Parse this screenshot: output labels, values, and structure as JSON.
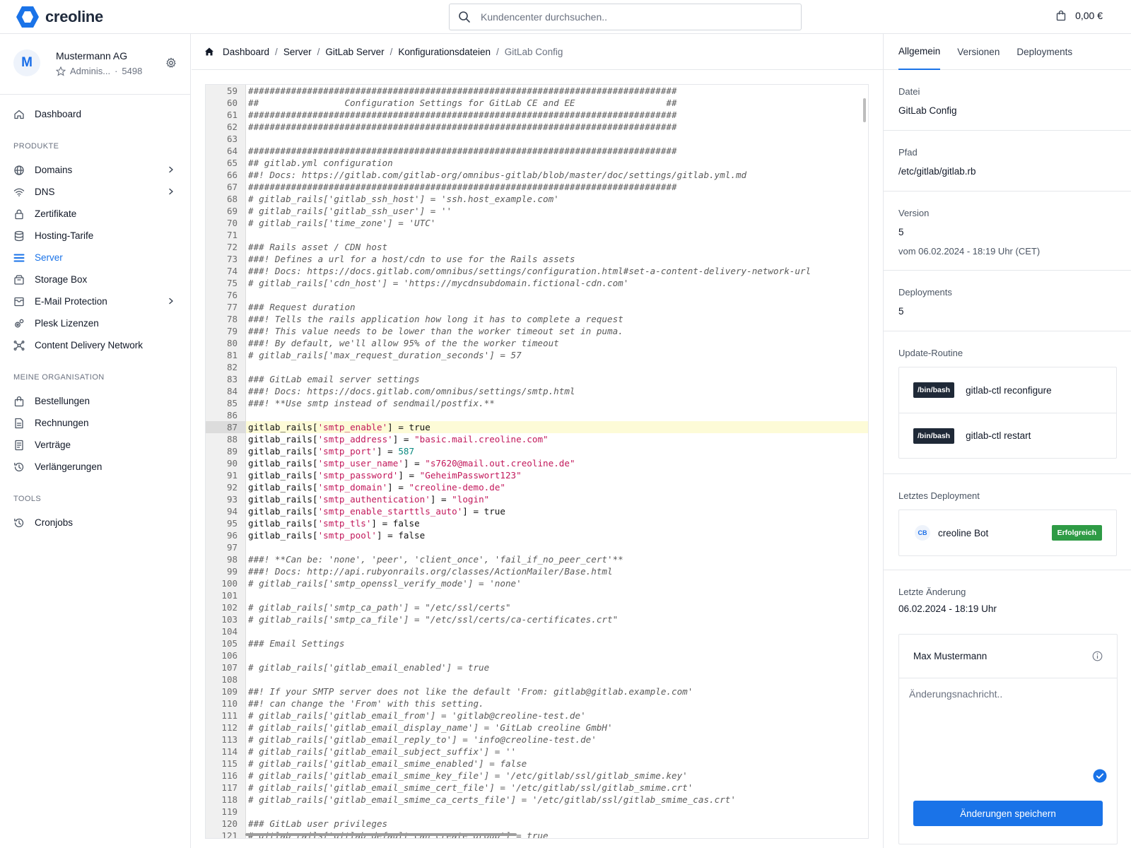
{
  "brand": {
    "name": "creoline",
    "color": "#1a73e8"
  },
  "search": {
    "placeholder": "Kundencenter durchsuchen.."
  },
  "cart": {
    "total": "0,00 €"
  },
  "account": {
    "initial": "M",
    "name": "Mustermann AG",
    "role": "Adminis...",
    "id": "5498"
  },
  "sidebar": {
    "top": [
      {
        "label": "Dashboard",
        "icon": "home-icon"
      }
    ],
    "sections": [
      {
        "title": "PRODUKTE",
        "items": [
          {
            "label": "Domains",
            "icon": "globe-icon",
            "chevron": true
          },
          {
            "label": "DNS",
            "icon": "wifi-icon",
            "chevron": true
          },
          {
            "label": "Zertifikate",
            "icon": "lock-icon"
          },
          {
            "label": "Hosting-Tarife",
            "icon": "database-icon"
          },
          {
            "label": "Server",
            "icon": "server-icon",
            "active": true
          },
          {
            "label": "Storage Box",
            "icon": "box-icon"
          },
          {
            "label": "E-Mail Protection",
            "icon": "mail-icon",
            "chevron": true
          },
          {
            "label": "Plesk Lizenzen",
            "icon": "gears-icon"
          },
          {
            "label": "Content Delivery Network",
            "icon": "network-icon"
          }
        ]
      },
      {
        "title": "MEINE ORGANISATION",
        "items": [
          {
            "label": "Bestellungen",
            "icon": "bag-icon"
          },
          {
            "label": "Rechnungen",
            "icon": "invoice-icon"
          },
          {
            "label": "Verträge",
            "icon": "contract-icon"
          },
          {
            "label": "Verlängerungen",
            "icon": "history-icon"
          }
        ]
      },
      {
        "title": "TOOLS",
        "items": [
          {
            "label": "Cronjobs",
            "icon": "clock-icon"
          }
        ]
      }
    ]
  },
  "breadcrumb": {
    "items": [
      "Dashboard",
      "Server",
      "GitLab Server",
      "Konfigurationsdateien"
    ],
    "current": "GitLab Config"
  },
  "editor": {
    "highlight_line": 87,
    "lines": [
      {
        "n": 59,
        "t": [
          [
            "c",
            "################################################################################"
          ]
        ]
      },
      {
        "n": 60,
        "t": [
          [
            "c",
            "##                Configuration Settings for GitLab CE and EE                 ##"
          ]
        ]
      },
      {
        "n": 61,
        "t": [
          [
            "c",
            "################################################################################"
          ]
        ]
      },
      {
        "n": 62,
        "t": [
          [
            "c",
            "################################################################################"
          ]
        ]
      },
      {
        "n": 63,
        "t": []
      },
      {
        "n": 64,
        "t": [
          [
            "c",
            "################################################################################"
          ]
        ]
      },
      {
        "n": 65,
        "t": [
          [
            "c",
            "## gitlab.yml configuration"
          ]
        ]
      },
      {
        "n": 66,
        "t": [
          [
            "c",
            "##! Docs: https://gitlab.com/gitlab-org/omnibus-gitlab/blob/master/doc/settings/gitlab.yml.md"
          ]
        ]
      },
      {
        "n": 67,
        "t": [
          [
            "c",
            "################################################################################"
          ]
        ]
      },
      {
        "n": 68,
        "t": [
          [
            "c",
            "# gitlab_rails['gitlab_ssh_host'] = 'ssh.host_example.com'"
          ]
        ]
      },
      {
        "n": 69,
        "t": [
          [
            "c",
            "# gitlab_rails['gitlab_ssh_user'] = ''"
          ]
        ]
      },
      {
        "n": 70,
        "t": [
          [
            "c",
            "# gitlab_rails['time_zone'] = 'UTC'"
          ]
        ]
      },
      {
        "n": 71,
        "t": []
      },
      {
        "n": 72,
        "t": [
          [
            "c",
            "### Rails asset / CDN host"
          ]
        ]
      },
      {
        "n": 73,
        "t": [
          [
            "c",
            "###! Defines a url for a host/cdn to use for the Rails assets"
          ]
        ]
      },
      {
        "n": 74,
        "t": [
          [
            "c",
            "###! Docs: https://docs.gitlab.com/omnibus/settings/configuration.html#set-a-content-delivery-network-url"
          ]
        ]
      },
      {
        "n": 75,
        "t": [
          [
            "c",
            "# gitlab_rails['cdn_host'] = 'https://mycdnsubdomain.fictional-cdn.com'"
          ]
        ]
      },
      {
        "n": 76,
        "t": []
      },
      {
        "n": 77,
        "t": [
          [
            "c",
            "### Request duration"
          ]
        ]
      },
      {
        "n": 78,
        "t": [
          [
            "c",
            "###! Tells the rails application how long it has to complete a request"
          ]
        ]
      },
      {
        "n": 79,
        "t": [
          [
            "c",
            "###! This value needs to be lower than the worker timeout set in puma."
          ]
        ]
      },
      {
        "n": 80,
        "t": [
          [
            "c",
            "###! By default, we'll allow 95% of the the worker timeout"
          ]
        ]
      },
      {
        "n": 81,
        "t": [
          [
            "c",
            "# gitlab_rails['max_request_duration_seconds'] = 57"
          ]
        ]
      },
      {
        "n": 82,
        "t": []
      },
      {
        "n": 83,
        "t": [
          [
            "c",
            "### GitLab email server settings"
          ]
        ]
      },
      {
        "n": 84,
        "t": [
          [
            "c",
            "###! Docs: https://docs.gitlab.com/omnibus/settings/smtp.html"
          ]
        ]
      },
      {
        "n": 85,
        "t": [
          [
            "c",
            "###! **Use smtp instead of sendmail/postfix.**"
          ]
        ]
      },
      {
        "n": 86,
        "t": []
      },
      {
        "n": 87,
        "t": [
          [
            "p",
            "gitlab_rails["
          ],
          [
            "s",
            "'smtp_enable'"
          ],
          [
            "p",
            "] = true"
          ]
        ]
      },
      {
        "n": 88,
        "t": [
          [
            "p",
            "gitlab_rails["
          ],
          [
            "s",
            "'smtp_address'"
          ],
          [
            "p",
            "] = "
          ],
          [
            "s",
            "\"basic.mail.creoline.com\""
          ]
        ]
      },
      {
        "n": 89,
        "t": [
          [
            "p",
            "gitlab_rails["
          ],
          [
            "s",
            "'smtp_port'"
          ],
          [
            "p",
            "] = "
          ],
          [
            "n",
            "587"
          ]
        ]
      },
      {
        "n": 90,
        "t": [
          [
            "p",
            "gitlab_rails["
          ],
          [
            "s",
            "'smtp_user_name'"
          ],
          [
            "p",
            "] = "
          ],
          [
            "s",
            "\"s7620@mail.out.creoline.de\""
          ]
        ]
      },
      {
        "n": 91,
        "t": [
          [
            "p",
            "gitlab_rails["
          ],
          [
            "s",
            "'smtp_password'"
          ],
          [
            "p",
            "] = "
          ],
          [
            "s",
            "\"GeheimPasswort123\""
          ]
        ]
      },
      {
        "n": 92,
        "t": [
          [
            "p",
            "gitlab_rails["
          ],
          [
            "s",
            "'smtp_domain'"
          ],
          [
            "p",
            "] = "
          ],
          [
            "s",
            "\"creoline-demo.de\""
          ]
        ]
      },
      {
        "n": 93,
        "t": [
          [
            "p",
            "gitlab_rails["
          ],
          [
            "s",
            "'smtp_authentication'"
          ],
          [
            "p",
            "] = "
          ],
          [
            "s",
            "\"login\""
          ]
        ]
      },
      {
        "n": 94,
        "t": [
          [
            "p",
            "gitlab_rails["
          ],
          [
            "s",
            "'smtp_enable_starttls_auto'"
          ],
          [
            "p",
            "] = true"
          ]
        ]
      },
      {
        "n": 95,
        "t": [
          [
            "p",
            "gitlab_rails["
          ],
          [
            "s",
            "'smtp_tls'"
          ],
          [
            "p",
            "] = false"
          ]
        ]
      },
      {
        "n": 96,
        "t": [
          [
            "p",
            "gitlab_rails["
          ],
          [
            "s",
            "'smtp_pool'"
          ],
          [
            "p",
            "] = false"
          ]
        ]
      },
      {
        "n": 97,
        "t": []
      },
      {
        "n": 98,
        "t": [
          [
            "c",
            "###! **Can be: 'none', 'peer', 'client_once', 'fail_if_no_peer_cert'**"
          ]
        ]
      },
      {
        "n": 99,
        "t": [
          [
            "c",
            "###! Docs: http://api.rubyonrails.org/classes/ActionMailer/Base.html"
          ]
        ]
      },
      {
        "n": 100,
        "t": [
          [
            "c",
            "# gitlab_rails['smtp_openssl_verify_mode'] = 'none'"
          ]
        ]
      },
      {
        "n": 101,
        "t": []
      },
      {
        "n": 102,
        "t": [
          [
            "c",
            "# gitlab_rails['smtp_ca_path'] = \"/etc/ssl/certs\""
          ]
        ]
      },
      {
        "n": 103,
        "t": [
          [
            "c",
            "# gitlab_rails['smtp_ca_file'] = \"/etc/ssl/certs/ca-certificates.crt\""
          ]
        ]
      },
      {
        "n": 104,
        "t": []
      },
      {
        "n": 105,
        "t": [
          [
            "c",
            "### Email Settings"
          ]
        ]
      },
      {
        "n": 106,
        "t": []
      },
      {
        "n": 107,
        "t": [
          [
            "c",
            "# gitlab_rails['gitlab_email_enabled'] = true"
          ]
        ]
      },
      {
        "n": 108,
        "t": []
      },
      {
        "n": 109,
        "t": [
          [
            "c",
            "##! If your SMTP server does not like the default 'From: gitlab@gitlab.example.com'"
          ]
        ]
      },
      {
        "n": 110,
        "t": [
          [
            "c",
            "##! can change the 'From' with this setting."
          ]
        ]
      },
      {
        "n": 111,
        "t": [
          [
            "c",
            "# gitlab_rails['gitlab_email_from'] = 'gitlab@creoline-test.de'"
          ]
        ]
      },
      {
        "n": 112,
        "t": [
          [
            "c",
            "# gitlab_rails['gitlab_email_display_name'] = 'GitLab creoline GmbH'"
          ]
        ]
      },
      {
        "n": 113,
        "t": [
          [
            "c",
            "# gitlab_rails['gitlab_email_reply_to'] = 'info@creoline-test.de'"
          ]
        ]
      },
      {
        "n": 114,
        "t": [
          [
            "c",
            "# gitlab_rails['gitlab_email_subject_suffix'] = ''"
          ]
        ]
      },
      {
        "n": 115,
        "t": [
          [
            "c",
            "# gitlab_rails['gitlab_email_smime_enabled'] = false"
          ]
        ]
      },
      {
        "n": 116,
        "t": [
          [
            "c",
            "# gitlab_rails['gitlab_email_smime_key_file'] = '/etc/gitlab/ssl/gitlab_smime.key'"
          ]
        ]
      },
      {
        "n": 117,
        "t": [
          [
            "c",
            "# gitlab_rails['gitlab_email_smime_cert_file'] = '/etc/gitlab/ssl/gitlab_smime.crt'"
          ]
        ]
      },
      {
        "n": 118,
        "t": [
          [
            "c",
            "# gitlab_rails['gitlab_email_smime_ca_certs_file'] = '/etc/gitlab/ssl/gitlab_smime_cas.crt'"
          ]
        ]
      },
      {
        "n": 119,
        "t": []
      },
      {
        "n": 120,
        "t": [
          [
            "c",
            "### GitLab user privileges"
          ]
        ]
      },
      {
        "n": 121,
        "t": [
          [
            "c",
            "# gitlab_rails['gitlab_default_can_create_group'] = true"
          ]
        ]
      }
    ]
  },
  "panel": {
    "tabs": [
      "Allgemein",
      "Versionen",
      "Deployments"
    ],
    "active_tab": "Allgemein",
    "file_label": "Datei",
    "file_value": "GitLab Config",
    "path_label": "Pfad",
    "path_value": "/etc/gitlab/gitlab.rb",
    "version_label": "Version",
    "version_value": "5",
    "version_date": "vom 06.02.2024 - 18:19 Uhr (CET)",
    "deployments_label": "Deployments",
    "deployments_value": "5",
    "routine_label": "Update-Routine",
    "routine": [
      {
        "shell": "/bin/bash",
        "command": "gitlab-ctl reconfigure"
      },
      {
        "shell": "/bin/bash",
        "command": "gitlab-ctl restart"
      }
    ],
    "last_deploy_label": "Letztes Deployment",
    "last_deploy_initials": "CB",
    "last_deploy_user": "creoline Bot",
    "last_deploy_status": "Erfolgreich",
    "last_change_label": "Letzte Änderung",
    "last_change_value": "06.02.2024 - 18:19 Uhr",
    "commit_user": "Max Mustermann",
    "commit_placeholder": "Änderungsnachricht..",
    "save_label": "Änderungen speichern"
  }
}
